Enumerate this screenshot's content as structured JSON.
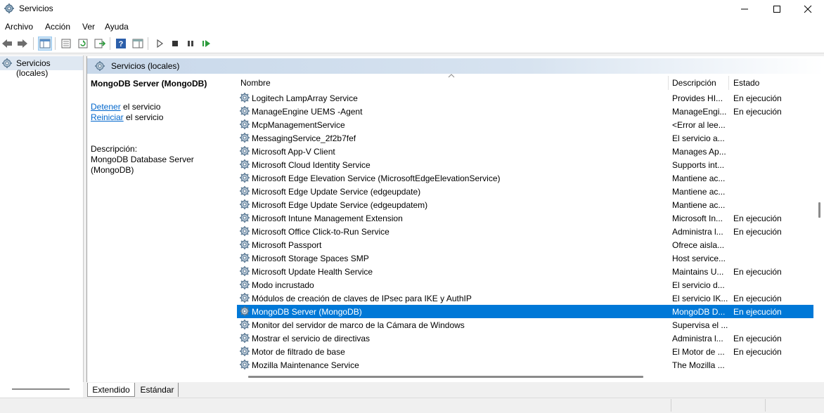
{
  "window": {
    "title": "Servicios",
    "icon": "services-gear-icon"
  },
  "menu": [
    "Archivo",
    "Acción",
    "Ver",
    "Ayuda"
  ],
  "tree": {
    "item": "Servicios (locales)"
  },
  "main": {
    "header": "Servicios (locales)",
    "selected_title": "MongoDB Server (MongoDB)",
    "stop_link": "Detener",
    "stop_suffix": " el servicio",
    "restart_link": "Reiniciar",
    "restart_suffix": " el servicio",
    "description_label": "Descripción:",
    "description_line1": "MongoDB Database Server",
    "description_line2": "(MongoDB)"
  },
  "columns": {
    "name": "Nombre",
    "description": "Descripción",
    "status": "Estado"
  },
  "services": [
    {
      "name": "Logitech LampArray Service",
      "desc": "Provides HI...",
      "status": "En ejecución"
    },
    {
      "name": "ManageEngine UEMS -Agent",
      "desc": "ManageEngi...",
      "status": "En ejecución"
    },
    {
      "name": "McpManagementService",
      "desc": "<Error al lee...",
      "status": ""
    },
    {
      "name": "MessagingService_2f2b7fef",
      "desc": "El servicio a...",
      "status": ""
    },
    {
      "name": "Microsoft App-V Client",
      "desc": "Manages Ap...",
      "status": ""
    },
    {
      "name": "Microsoft Cloud Identity Service",
      "desc": "Supports int...",
      "status": ""
    },
    {
      "name": "Microsoft Edge Elevation Service (MicrosoftEdgeElevationService)",
      "desc": "Mantiene ac...",
      "status": ""
    },
    {
      "name": "Microsoft Edge Update Service (edgeupdate)",
      "desc": "Mantiene ac...",
      "status": ""
    },
    {
      "name": "Microsoft Edge Update Service (edgeupdatem)",
      "desc": "Mantiene ac...",
      "status": ""
    },
    {
      "name": "Microsoft Intune Management Extension",
      "desc": "Microsoft In...",
      "status": "En ejecución"
    },
    {
      "name": "Microsoft Office Click-to-Run Service",
      "desc": "Administra l...",
      "status": "En ejecución"
    },
    {
      "name": "Microsoft Passport",
      "desc": "Ofrece aisla...",
      "status": ""
    },
    {
      "name": "Microsoft Storage Spaces SMP",
      "desc": "Host service...",
      "status": ""
    },
    {
      "name": "Microsoft Update Health Service",
      "desc": "Maintains U...",
      "status": "En ejecución"
    },
    {
      "name": "Modo incrustado",
      "desc": "El servicio d...",
      "status": ""
    },
    {
      "name": "Módulos de creación de claves de IPsec para IKE y AuthIP",
      "desc": "El servicio IK...",
      "status": "En ejecución"
    },
    {
      "name": "MongoDB Server (MongoDB)",
      "desc": "MongoDB D...",
      "status": "En ejecución",
      "selected": true
    },
    {
      "name": "Monitor del servidor de marco de la Cámara de Windows",
      "desc": "Supervisa el ...",
      "status": ""
    },
    {
      "name": "Mostrar el servicio de directivas",
      "desc": "Administra l...",
      "status": "En ejecución"
    },
    {
      "name": "Motor de filtrado de base",
      "desc": "El Motor de ...",
      "status": "En ejecución"
    },
    {
      "name": "Mozilla Maintenance Service",
      "desc": "The Mozilla ...",
      "status": ""
    }
  ],
  "tabs": [
    "Extendido",
    "Estándar"
  ],
  "colors": {
    "selection": "#0078d7",
    "link": "#0066cc",
    "header_gradient": "#c8d8ea"
  }
}
